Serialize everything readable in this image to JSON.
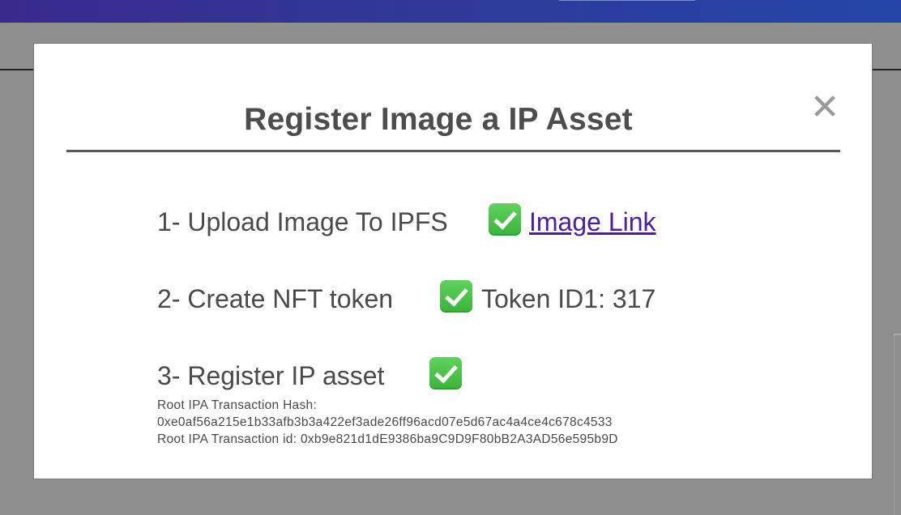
{
  "modal": {
    "title": "Register Image a IP Asset",
    "close_label": "✕"
  },
  "steps": [
    {
      "label": "1- Upload Image To IPFS",
      "status_icon": "check-mark-icon",
      "link_text": "Image Link"
    },
    {
      "label": "2- Create NFT token",
      "status_icon": "check-mark-icon",
      "result": "Token ID1: 317"
    },
    {
      "label": "3- Register IP asset",
      "status_icon": "check-mark-icon"
    }
  ],
  "transaction": {
    "hash_label": "Root IPA Transaction Hash:",
    "hash_value": "0xe0af56a215e1b33afb3b3a422ef3ade26ff96acd07e5d67ac4a4ce4c678c4533",
    "id_line": "Root IPA Transaction id: 0xb9e821d1dE9386ba9C9D9F80bB2A3AD56e595b9D"
  },
  "colors": {
    "header_gradient_start": "#3a2a8c",
    "header_gradient_end": "#2546a8",
    "check_green": "#3bb33a",
    "link_purple": "#4b1fa3",
    "overlay_gray": "#8f8f8f"
  }
}
